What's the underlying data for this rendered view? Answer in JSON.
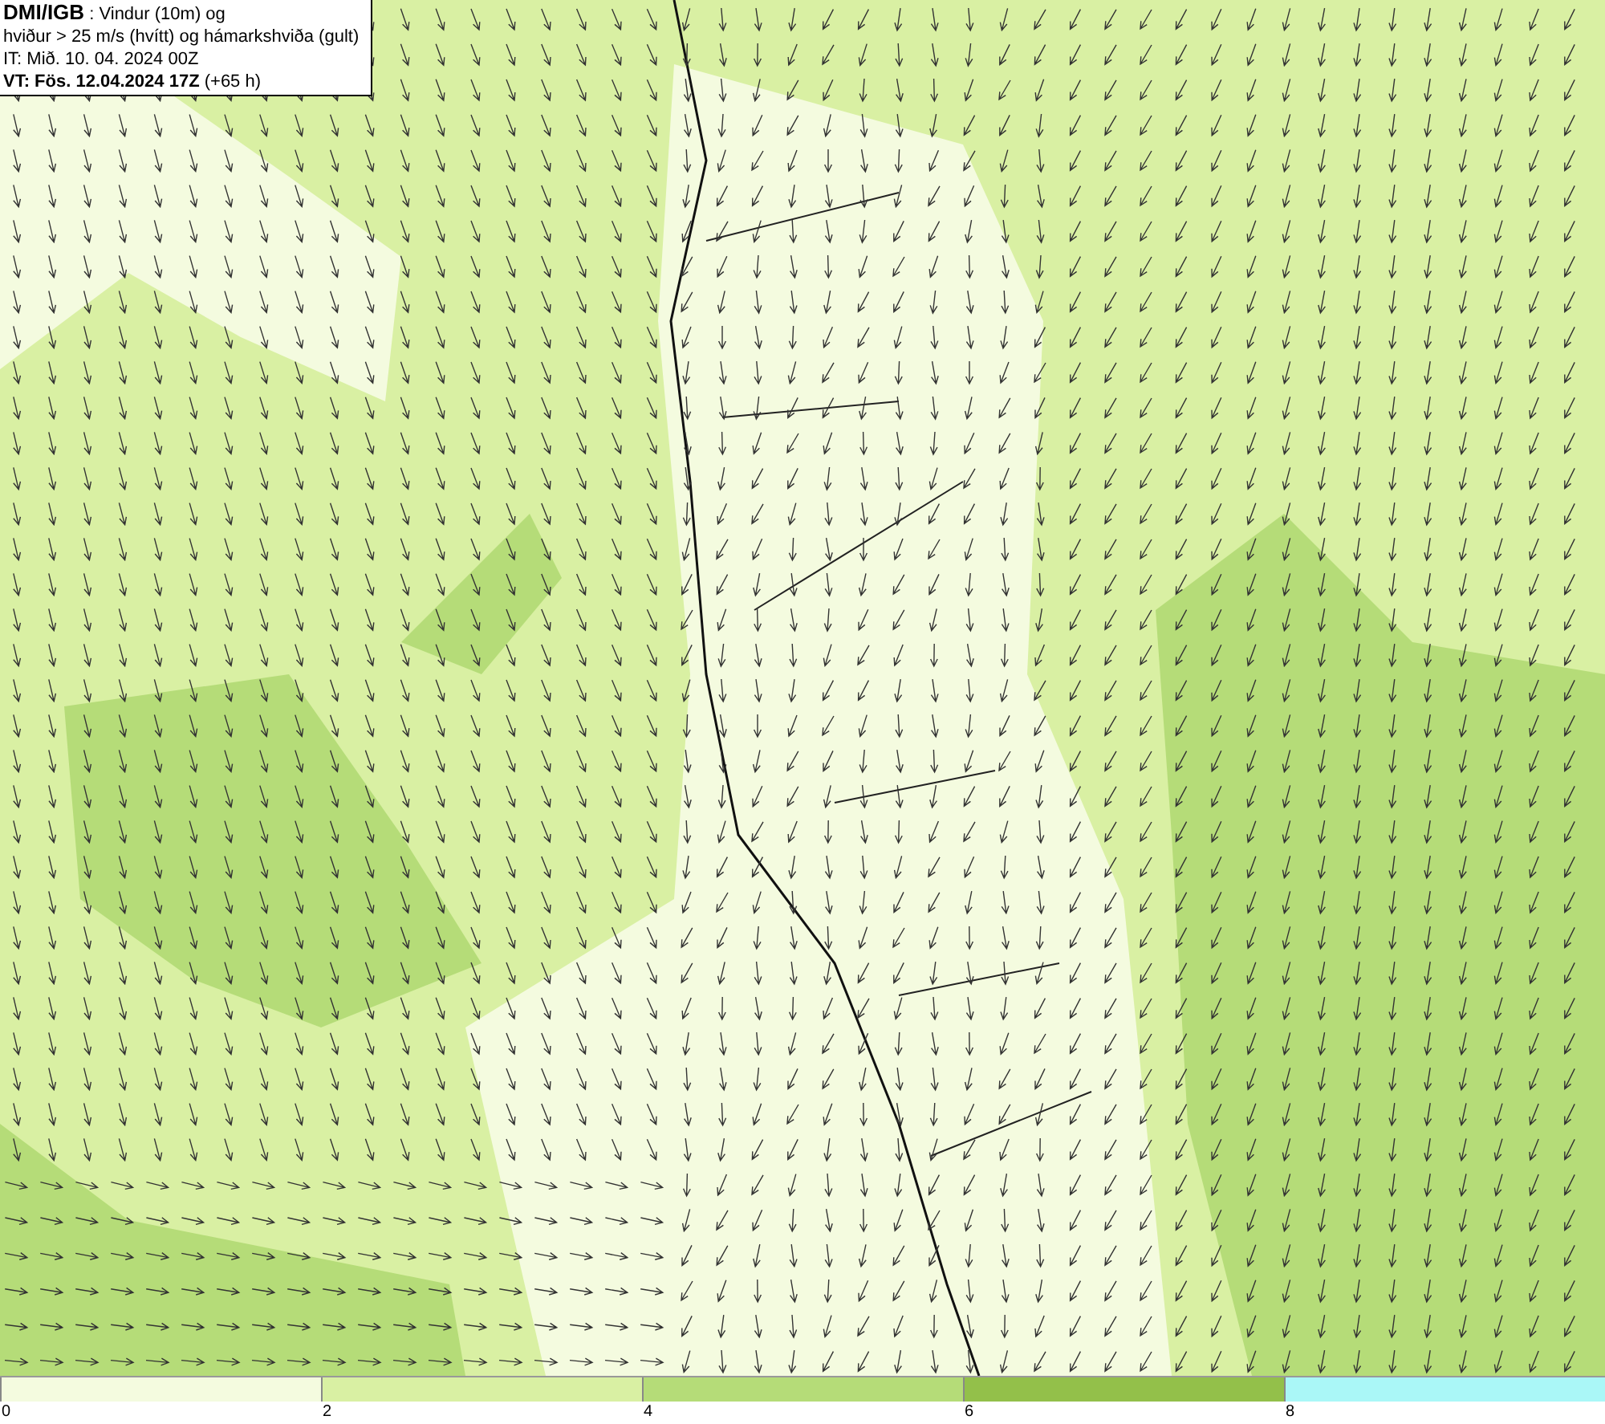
{
  "header": {
    "lines": [
      "**DMI/IGB** : Vindur (10m) og",
      "hviður > 25 m/s (hvítt) og hámarkshviða (gult)",
      "IT: Mið. 10. 04. 2024 00Z",
      "**VT: Fös. 12.04.2024 17Z** (+65 h)"
    ]
  },
  "legend": {
    "segments": [
      {
        "color": "#f4fbdf",
        "label": "0"
      },
      {
        "color": "#d9f0a3",
        "label": "2"
      },
      {
        "color": "#b5dc78",
        "label": "4"
      },
      {
        "color": "#93c04a",
        "label": "6"
      },
      {
        "color": "#aaf7f7",
        "label": "8"
      }
    ]
  }
}
